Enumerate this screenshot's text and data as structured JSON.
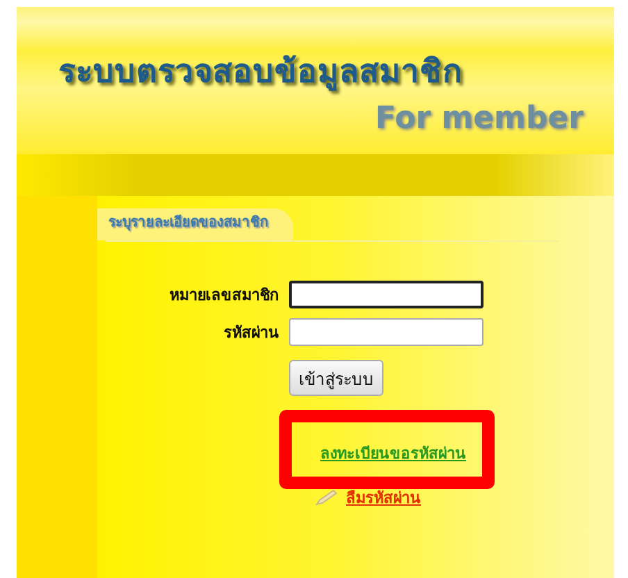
{
  "header": {
    "title": "ระบบตรวจสอบข้อมูลสมาชิก",
    "subtitle": "For member"
  },
  "section": {
    "title": "ระบุรายละเอียดของสมาชิก"
  },
  "fields": [
    {
      "label": "หมายเลขสมาชิก",
      "focused": true
    },
    {
      "label": "รหัสผ่าน",
      "focused": false
    }
  ],
  "login_button": "เข้าสู่ระบบ",
  "links": [
    {
      "label": "ลงทะเบียนขอรหัสผ่าน",
      "kind": "register",
      "highlighted": true
    },
    {
      "label": "ลืมรหัสผ่าน",
      "kind": "forgot",
      "highlighted": false
    }
  ]
}
